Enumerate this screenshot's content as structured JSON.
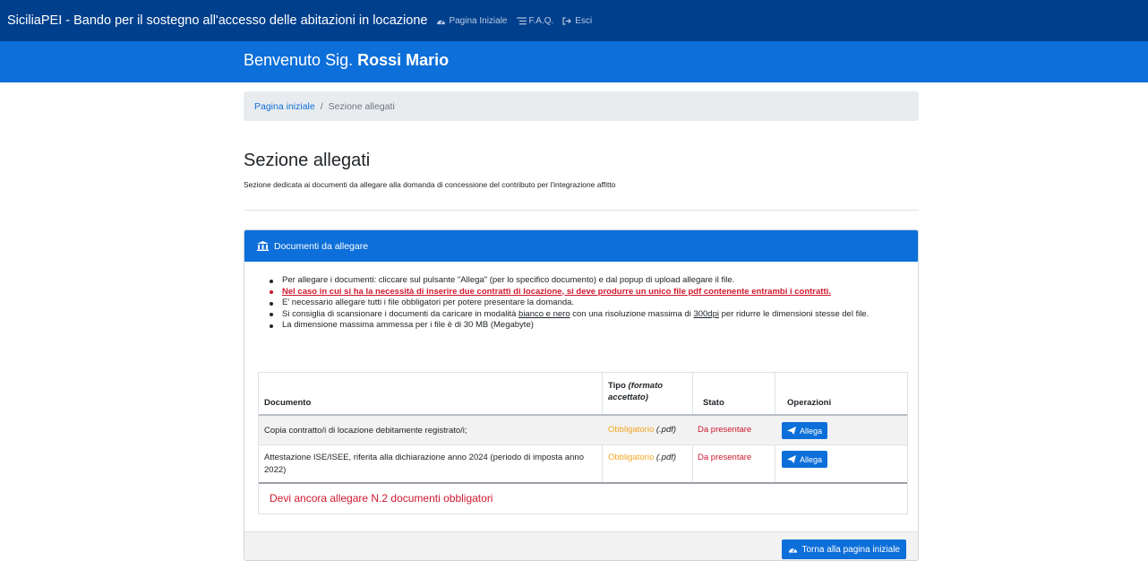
{
  "nav": {
    "brand": "SiciliaPEI - Bando per il sostegno all'accesso delle abitazioni in locazione",
    "links": [
      {
        "label": "Pagina Iniziale",
        "icon": "dashboard-icon"
      },
      {
        "label": "F.A.Q.",
        "icon": "list-icon"
      },
      {
        "label": "Esci",
        "icon": "sign-out-icon"
      }
    ]
  },
  "welcome": {
    "prefix": "Benvenuto Sig.",
    "name": "Rossi Mario"
  },
  "breadcrumb": {
    "home": "Pagina iniziale",
    "separator": "/",
    "current": "Sezione allegati"
  },
  "page": {
    "title": "Sezione allegati",
    "subtitle": "Sezione dedicata ai documenti da allegare alla domanda di concessione del contributo per l'integrazione affitto"
  },
  "card": {
    "title": "Documenti da allegare",
    "instructions": {
      "b1": "Per allegare i documenti: cliccare sul pulsante \"Allega\" (per lo specifico documento) e dal popup di upload allegare il file.",
      "b2": "Nel caso in cui si ha la necessità di inserire due contratti di locazione, si deve produrre un unico file pdf contenente entrambi i contratti.",
      "b3": "E' necessario allegare tutti i file obbligatori per potere presentare la domanda.",
      "b4_pre": "Si consiglia di scansionare i documenti da caricare in modalità ",
      "b4_bw": "bianco e nero",
      "b4_mid": " con una risoluzione massima di ",
      "b4_dpi": "300dpi",
      "b4_post": " per ridurre le dimensioni stesse del file.",
      "b5": "La dimensione massima ammessa per i file è di 30 MB (Megabyte)"
    },
    "table": {
      "headers": {
        "documento": "Documento",
        "tipo": "Tipo",
        "tipo_note": "(formato accettato)",
        "stato": "Stato",
        "operazioni": "Operazioni"
      },
      "rows": [
        {
          "documento": "Copia contratto/i di locazione debitamente registrato/i;",
          "tipo": "Obbligatorio",
          "formato": "(.pdf)",
          "stato": "Da presentare",
          "azione": "Allega"
        },
        {
          "documento": "Attestazione ISE/ISEE, riferita alla dichiarazione anno 2024 (periodo di imposta anno 2022)",
          "tipo": "Obbligatorio",
          "formato": "(.pdf)",
          "stato": "Da presentare",
          "azione": "Allega"
        }
      ],
      "warning": "Devi ancora allegare N.2 documenti obbligatori"
    },
    "footer_button": "Torna alla pagina iniziale"
  },
  "colors": {
    "navbar": "#003f8c",
    "primary": "#0d6fd9",
    "danger": "#d0182f",
    "warning": "#f5a623"
  }
}
